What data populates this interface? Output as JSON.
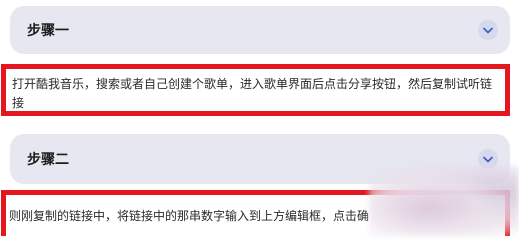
{
  "steps": [
    {
      "title": "步骤一",
      "expand_icon": "chevron-down-icon",
      "text_line1": "打开酷我音乐，搜索或者自己创建个歌单，进入歌单界面后点击分享按钮，然后复制试听链",
      "text_line2": "接"
    },
    {
      "title": "步骤二",
      "expand_icon": "chevron-down-icon",
      "text_line1": "则刚复制的链接中，将链接中的那串数字输入到上方编辑框，点击确"
    }
  ],
  "colors": {
    "header_bg": "#e6e7f1",
    "highlight_border": "#e5161f",
    "chevron_bg": "#d6d9ee",
    "chevron_stroke": "#3a5bbf"
  }
}
